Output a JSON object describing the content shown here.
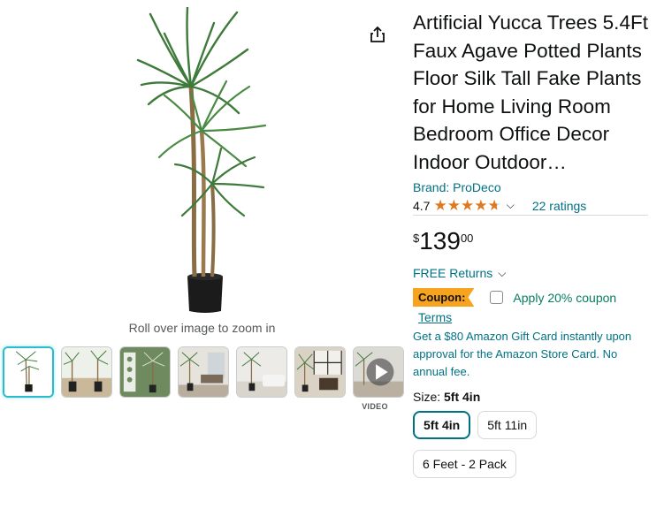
{
  "product": {
    "title": "Artificial Yucca Trees 5.4Ft Faux Agave Potted Plants Floor Silk Tall Fake Plants for Home Living Room Bedroom Office Decor Indoor Outdoor…",
    "brand": "Brand: ProDeco",
    "rating_value": "4.7",
    "rating_stars": 4.7,
    "ratings_count": "22 ratings",
    "price_symbol": "$",
    "price_whole": "139",
    "price_fraction": "00",
    "free_returns": "FREE Returns",
    "coupon_badge": "Coupon:",
    "coupon_text": "Apply 20% coupon",
    "terms": "Terms",
    "gift_card": "Get a $80 Amazon Gift Card instantly upon approval for the Amazon Store Card. No annual fee.",
    "size_label": "Size:",
    "size_selected": "5ft 4in",
    "sizes": [
      "5ft 4in",
      "5ft 11in",
      "6 Feet - 2 Pack"
    ]
  },
  "gallery": {
    "zoom_hint": "Roll over image to zoom in",
    "video_label": "VIDEO",
    "thumbnails": [
      "plant-front",
      "plant-pair",
      "plant-infographic",
      "plant-room-1",
      "plant-room-2",
      "plant-room-3",
      "video"
    ]
  },
  "icons": {
    "share": "share-icon",
    "chevron": "chevron-down-icon",
    "play": "play-icon"
  },
  "colors": {
    "link": "#007185",
    "star": "#de7921",
    "coupon": "#f7a31d",
    "coupon_text": "#067d62",
    "selected_thumb": "#2abbcc"
  }
}
